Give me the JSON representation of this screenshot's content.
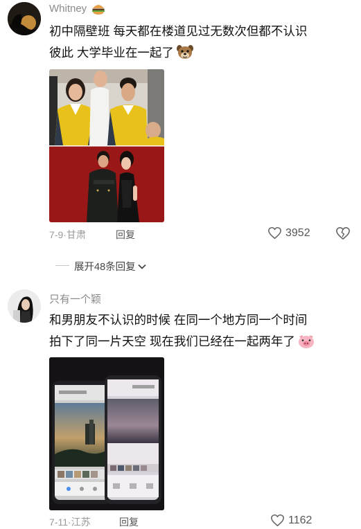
{
  "comments": [
    {
      "username": "Whitney",
      "text_line1": "初中隔壁班 每天都在楼道见过无数次但都不认识",
      "text_line2": "彼此 大学毕业在一起了",
      "emoji": "dog-face-emoji",
      "date": "7-9",
      "location": "甘肃",
      "reply_label": "回复",
      "likes": "3952",
      "expand_replies": "展开48条回复"
    },
    {
      "username": "只有一个颖",
      "text_line1": "和男朋友不认识的时候 在同一个地方同一个时间",
      "text_line2": "拍下了同一片天空 现在我们已经在一起两年了",
      "emoji": "pig-face-emoji",
      "date": "7-11",
      "location": "江苏",
      "reply_label": "回复",
      "likes": "1162"
    }
  ],
  "colors": {
    "username": "#8a8a8a",
    "meta": "#9a9a9a",
    "text": "#111111",
    "photo_red": "#8e1414",
    "uniform_yellow": "#e8c21a"
  },
  "icons": [
    "heart-icon",
    "broken-heart-icon",
    "chevron-down-icon",
    "burger-emoji"
  ]
}
